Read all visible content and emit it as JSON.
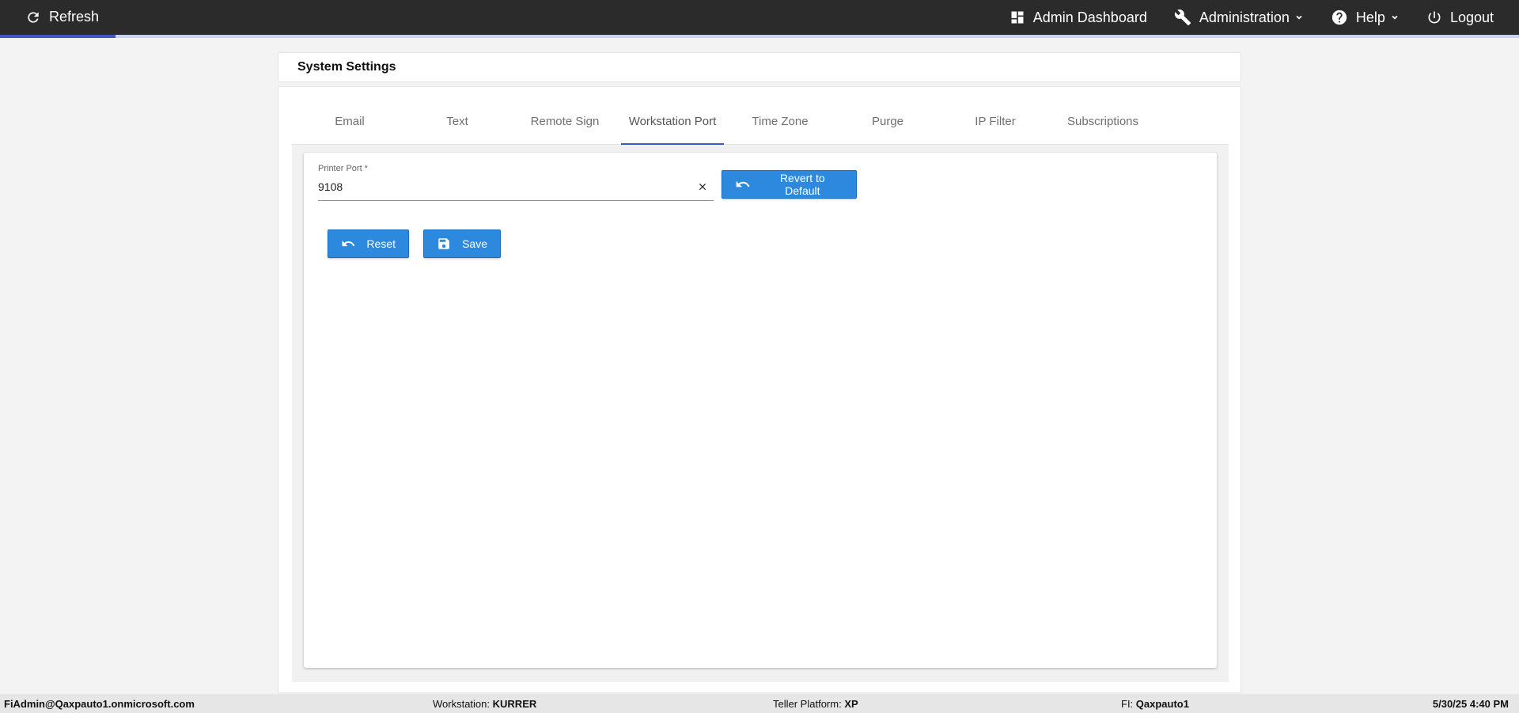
{
  "topbar": {
    "refresh_label": "Refresh",
    "admin_dashboard_label": "Admin Dashboard",
    "administration_label": "Administration",
    "help_label": "Help",
    "logout_label": "Logout",
    "progress_fraction": 0.076
  },
  "header": {
    "title": "System Settings"
  },
  "tabs": [
    {
      "label": "Email"
    },
    {
      "label": "Text"
    },
    {
      "label": "Remote Sign"
    },
    {
      "label": "Workstation Port",
      "active": true
    },
    {
      "label": "Time Zone"
    },
    {
      "label": "Purge"
    },
    {
      "label": "IP Filter"
    },
    {
      "label": "Subscriptions"
    }
  ],
  "form": {
    "printer_port_label": "Printer Port *",
    "printer_port_value": "9108",
    "revert_label": "Revert to Default",
    "reset_label": "Reset",
    "save_label": "Save"
  },
  "footer": {
    "user": "FiAdmin@Qaxpauto1.onmicrosoft.com",
    "workstation_label": "Workstation:",
    "workstation_value": "KURRER",
    "teller_label": "Teller Platform:",
    "teller_value": "XP",
    "fi_label": "FI:",
    "fi_value": "Qaxpauto1",
    "datetime": "5/30/25 4:40 PM"
  },
  "colors": {
    "topbar": "#2b2b2b",
    "accent": "#3f56c9",
    "button": "#2d89dd"
  }
}
